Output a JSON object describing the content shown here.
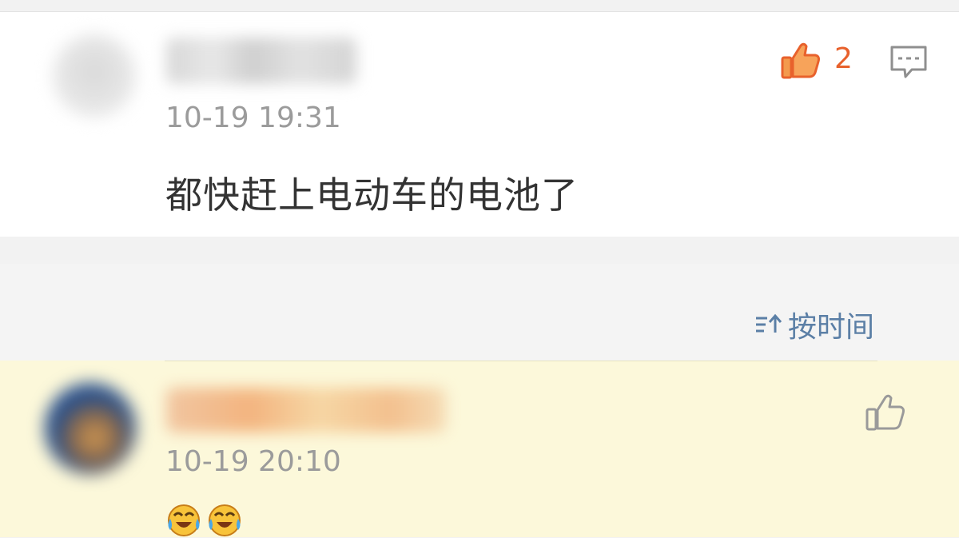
{
  "comment_top": {
    "timestamp": "10-19 19:31",
    "text": "都快赶上电动车的电池了",
    "like_count": "2",
    "like_color": "#e8612c"
  },
  "sort": {
    "label": "按时间",
    "color": "#5b7fa6"
  },
  "comment_reply": {
    "timestamp": "10-19 20:10",
    "emojis": [
      "laughing-crying-emoji",
      "laughing-crying-emoji"
    ]
  }
}
